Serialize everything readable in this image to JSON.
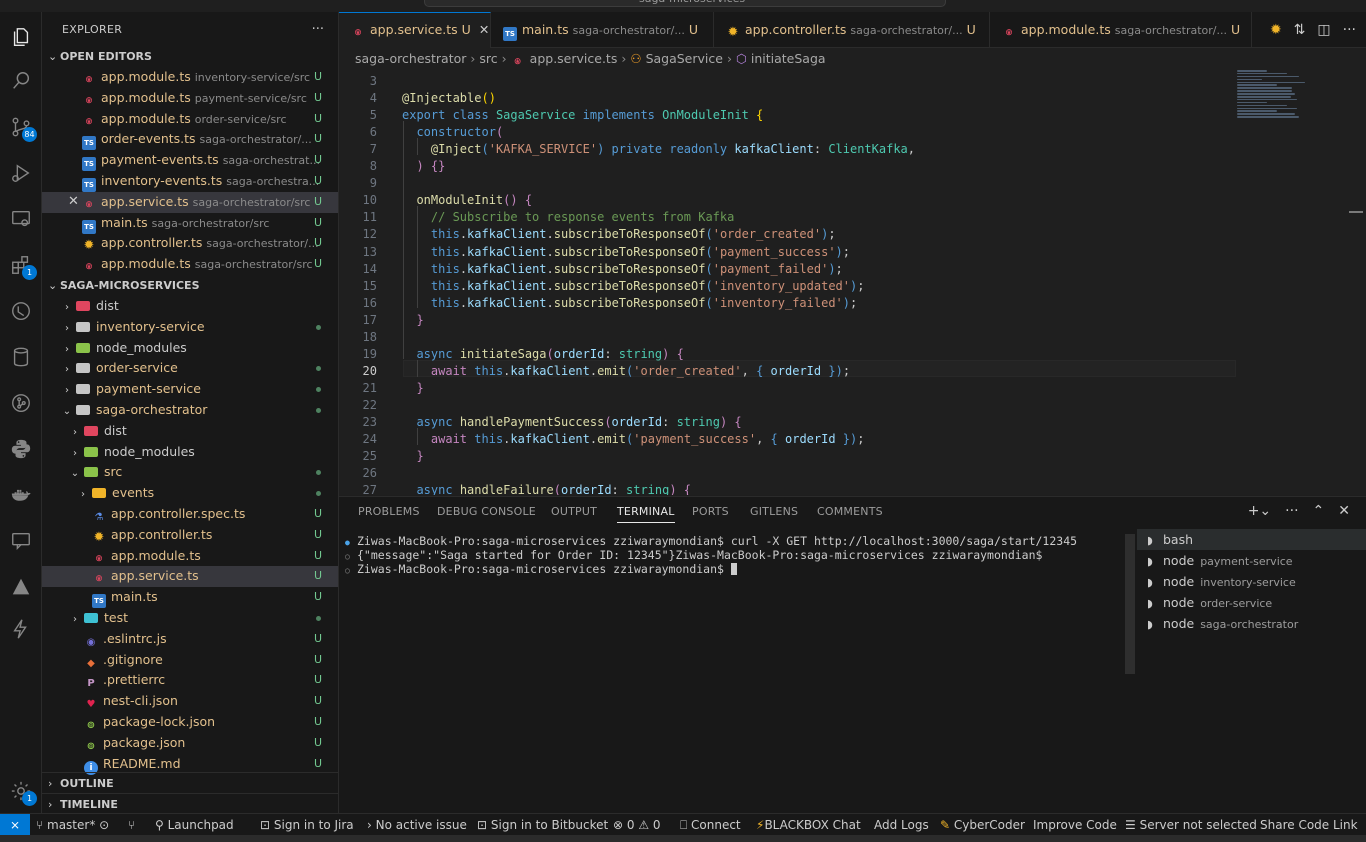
{
  "titlebar": {
    "search_text": "saga-microservices"
  },
  "explorer": {
    "title": "EXPLORER",
    "more": "···",
    "open_editors": {
      "label": "OPEN EDITORS",
      "items": [
        {
          "icon": "angular",
          "name": "app.module.ts",
          "desc": "inventory-service/src",
          "status": "U"
        },
        {
          "icon": "angular",
          "name": "app.module.ts",
          "desc": "payment-service/src",
          "status": "U"
        },
        {
          "icon": "angular",
          "name": "app.module.ts",
          "desc": "order-service/src",
          "status": "U"
        },
        {
          "icon": "ts",
          "name": "order-events.ts",
          "desc": "saga-orchestrator/...",
          "status": "U"
        },
        {
          "icon": "ts",
          "name": "payment-events.ts",
          "desc": "saga-orchestrat...",
          "status": "U"
        },
        {
          "icon": "ts",
          "name": "inventory-events.ts",
          "desc": "saga-orchestra...",
          "status": "U"
        },
        {
          "icon": "angular",
          "name": "app.service.ts",
          "desc": "saga-orchestrator/src",
          "status": "U"
        },
        {
          "icon": "ts",
          "name": "main.ts",
          "desc": "saga-orchestrator/src",
          "status": "U"
        },
        {
          "icon": "gear",
          "name": "app.controller.ts",
          "desc": "saga-orchestrator/...",
          "status": "U"
        },
        {
          "icon": "angular",
          "name": "app.module.ts",
          "desc": "saga-orchestrator/src",
          "status": "U"
        }
      ]
    },
    "workspace": {
      "label": "SAGA-MICROSERVICES",
      "items": [
        {
          "name": "dist",
          "status": ""
        },
        {
          "name": "inventory-service",
          "status": "dot"
        },
        {
          "name": "node_modules",
          "status": ""
        },
        {
          "name": "order-service",
          "status": "dot"
        },
        {
          "name": "payment-service",
          "status": "dot"
        },
        {
          "name": "saga-orchestrator",
          "status": "dot"
        },
        {
          "name": "dist",
          "status": ""
        },
        {
          "name": "node_modules",
          "status": ""
        },
        {
          "name": "src",
          "status": "dot"
        },
        {
          "name": "events",
          "status": "dot"
        },
        {
          "name": "app.controller.spec.ts",
          "status": "U"
        },
        {
          "name": "app.controller.ts",
          "status": "U"
        },
        {
          "name": "app.module.ts",
          "status": "U"
        },
        {
          "name": "app.service.ts",
          "status": "U"
        },
        {
          "name": "main.ts",
          "status": "U"
        },
        {
          "name": "test",
          "status": "dot"
        },
        {
          "name": ".eslintrc.js",
          "status": "U"
        },
        {
          "name": ".gitignore",
          "status": "U"
        },
        {
          "name": ".prettierrc",
          "status": "U"
        },
        {
          "name": "nest-cli.json",
          "status": "U"
        },
        {
          "name": "package-lock.json",
          "status": "U"
        },
        {
          "name": "package.json",
          "status": "U"
        },
        {
          "name": "README.md",
          "status": "U"
        }
      ]
    },
    "outline_label": "OUTLINE",
    "timeline_label": "TIMELINE"
  },
  "activity": {
    "scm_badge": "84",
    "ext_badge": "1",
    "accounts_badge": "1"
  },
  "tabs": [
    {
      "name": "app.service.ts",
      "status": "U",
      "desc": "",
      "active": true
    },
    {
      "name": "main.ts",
      "status": "",
      "desc": "saga-orchestrator/...",
      "statusAfter": "U"
    },
    {
      "name": "app.controller.ts",
      "status": "",
      "desc": "saga-orchestrator/...",
      "statusAfter": "U"
    },
    {
      "name": "app.module.ts",
      "status": "",
      "desc": "saga-orchestrator/...",
      "statusAfter": "U"
    }
  ],
  "breadcrumb": [
    "saga-orchestrator",
    "src",
    "app.service.ts",
    "SagaService",
    "initiateSaga"
  ],
  "editor": {
    "current_line": 20,
    "lines": [
      {
        "n": 3,
        "tokens": []
      },
      {
        "n": 4,
        "tokens": [
          [
            "fn",
            "@Injectable"
          ],
          [
            "pun",
            "()"
          ]
        ]
      },
      {
        "n": 5,
        "tokens": [
          [
            "kb",
            "export "
          ],
          [
            "kb",
            "class "
          ],
          [
            "cls",
            "SagaService "
          ],
          [
            "kb",
            "implements "
          ],
          [
            "cls",
            "OnModuleInit "
          ],
          [
            "pun",
            "{"
          ]
        ]
      },
      {
        "n": 6,
        "tokens": [
          [
            "",
            "  "
          ],
          [
            "kb",
            "constructor"
          ],
          [
            "kw",
            "("
          ]
        ]
      },
      {
        "n": 7,
        "tokens": [
          [
            "",
            "    "
          ],
          [
            "fn",
            "@Inject"
          ],
          [
            "kb",
            "("
          ],
          [
            "str",
            "'KAFKA_SERVICE'"
          ],
          [
            "kb",
            ") "
          ],
          [
            "kb",
            "private "
          ],
          [
            "kb",
            "readonly "
          ],
          [
            "prop",
            "kafkaClient"
          ],
          [
            "",
            ": "
          ],
          [
            "cls",
            "ClientKafka"
          ],
          [
            "",
            ","
          ]
        ]
      },
      {
        "n": 8,
        "tokens": [
          [
            "",
            "  "
          ],
          [
            "kw",
            ") {}"
          ]
        ]
      },
      {
        "n": 9,
        "tokens": []
      },
      {
        "n": 10,
        "tokens": [
          [
            "",
            "  "
          ],
          [
            "fn",
            "onModuleInit"
          ],
          [
            "kw",
            "() {"
          ]
        ]
      },
      {
        "n": 11,
        "tokens": [
          [
            "",
            "    "
          ],
          [
            "cmt",
            "// Subscribe to response events from Kafka"
          ]
        ]
      },
      {
        "n": 12,
        "tokens": [
          [
            "",
            "    "
          ],
          [
            "kb",
            "this"
          ],
          [
            "",
            "."
          ],
          [
            "prop",
            "kafkaClient"
          ],
          [
            "",
            "."
          ],
          [
            "fn",
            "subscribeToResponseOf"
          ],
          [
            "kb",
            "("
          ],
          [
            "str",
            "'order_created'"
          ],
          [
            "kb",
            ")"
          ],
          [
            "",
            ";"
          ]
        ]
      },
      {
        "n": 13,
        "tokens": [
          [
            "",
            "    "
          ],
          [
            "kb",
            "this"
          ],
          [
            "",
            "."
          ],
          [
            "prop",
            "kafkaClient"
          ],
          [
            "",
            "."
          ],
          [
            "fn",
            "subscribeToResponseOf"
          ],
          [
            "kb",
            "("
          ],
          [
            "str",
            "'payment_success'"
          ],
          [
            "kb",
            ")"
          ],
          [
            "",
            ";"
          ]
        ]
      },
      {
        "n": 14,
        "tokens": [
          [
            "",
            "    "
          ],
          [
            "kb",
            "this"
          ],
          [
            "",
            "."
          ],
          [
            "prop",
            "kafkaClient"
          ],
          [
            "",
            "."
          ],
          [
            "fn",
            "subscribeToResponseOf"
          ],
          [
            "kb",
            "("
          ],
          [
            "str",
            "'payment_failed'"
          ],
          [
            "kb",
            ")"
          ],
          [
            "",
            ";"
          ]
        ]
      },
      {
        "n": 15,
        "tokens": [
          [
            "",
            "    "
          ],
          [
            "kb",
            "this"
          ],
          [
            "",
            "."
          ],
          [
            "prop",
            "kafkaClient"
          ],
          [
            "",
            "."
          ],
          [
            "fn",
            "subscribeToResponseOf"
          ],
          [
            "kb",
            "("
          ],
          [
            "str",
            "'inventory_updated'"
          ],
          [
            "kb",
            ")"
          ],
          [
            "",
            ";"
          ]
        ]
      },
      {
        "n": 16,
        "tokens": [
          [
            "",
            "    "
          ],
          [
            "kb",
            "this"
          ],
          [
            "",
            "."
          ],
          [
            "prop",
            "kafkaClient"
          ],
          [
            "",
            "."
          ],
          [
            "fn",
            "subscribeToResponseOf"
          ],
          [
            "kb",
            "("
          ],
          [
            "str",
            "'inventory_failed'"
          ],
          [
            "kb",
            ")"
          ],
          [
            "",
            ";"
          ]
        ]
      },
      {
        "n": 17,
        "tokens": [
          [
            "",
            "  "
          ],
          [
            "kw",
            "}"
          ]
        ]
      },
      {
        "n": 18,
        "tokens": []
      },
      {
        "n": 19,
        "tokens": [
          [
            "",
            "  "
          ],
          [
            "kb",
            "async "
          ],
          [
            "fn",
            "initiateSaga"
          ],
          [
            "kw",
            "("
          ],
          [
            "prop",
            "orderId"
          ],
          [
            "",
            ": "
          ],
          [
            "cls",
            "string"
          ],
          [
            "kw",
            ") {"
          ]
        ]
      },
      {
        "n": 20,
        "tokens": [
          [
            "",
            "    "
          ],
          [
            "kw",
            "await "
          ],
          [
            "kb",
            "this"
          ],
          [
            "",
            "."
          ],
          [
            "prop",
            "kafkaClient"
          ],
          [
            "",
            "."
          ],
          [
            "fn",
            "emit"
          ],
          [
            "kb",
            "("
          ],
          [
            "str",
            "'order_created'"
          ],
          [
            "",
            ", "
          ],
          [
            "kb",
            "{ "
          ],
          [
            "prop",
            "orderId"
          ],
          [
            "kb",
            " }"
          ],
          [
            "kb",
            ")"
          ],
          [
            "",
            ";"
          ]
        ]
      },
      {
        "n": 21,
        "tokens": [
          [
            "",
            "  "
          ],
          [
            "kw",
            "}"
          ]
        ]
      },
      {
        "n": 22,
        "tokens": []
      },
      {
        "n": 23,
        "tokens": [
          [
            "",
            "  "
          ],
          [
            "kb",
            "async "
          ],
          [
            "fn",
            "handlePaymentSuccess"
          ],
          [
            "kw",
            "("
          ],
          [
            "prop",
            "orderId"
          ],
          [
            "",
            ": "
          ],
          [
            "cls",
            "string"
          ],
          [
            "kw",
            ") {"
          ]
        ]
      },
      {
        "n": 24,
        "tokens": [
          [
            "",
            "    "
          ],
          [
            "kw",
            "await "
          ],
          [
            "kb",
            "this"
          ],
          [
            "",
            "."
          ],
          [
            "prop",
            "kafkaClient"
          ],
          [
            "",
            "."
          ],
          [
            "fn",
            "emit"
          ],
          [
            "kb",
            "("
          ],
          [
            "str",
            "'payment_success'"
          ],
          [
            "",
            ", "
          ],
          [
            "kb",
            "{ "
          ],
          [
            "prop",
            "orderId"
          ],
          [
            "kb",
            " }"
          ],
          [
            "kb",
            ")"
          ],
          [
            "",
            ";"
          ]
        ]
      },
      {
        "n": 25,
        "tokens": [
          [
            "",
            "  "
          ],
          [
            "kw",
            "}"
          ]
        ]
      },
      {
        "n": 26,
        "tokens": []
      },
      {
        "n": 27,
        "tokens": [
          [
            "",
            "  "
          ],
          [
            "kb",
            "async "
          ],
          [
            "fn",
            "handleFailure"
          ],
          [
            "kw",
            "("
          ],
          [
            "prop",
            "orderId"
          ],
          [
            "",
            ": "
          ],
          [
            "cls",
            "string"
          ],
          [
            "kw",
            ") {"
          ]
        ]
      }
    ]
  },
  "panel": {
    "tabs": [
      "PROBLEMS",
      "DEBUG CONSOLE",
      "OUTPUT",
      "TERMINAL",
      "PORTS",
      "GITLENS",
      "COMMENTS"
    ],
    "active_tab": "TERMINAL",
    "terminal_lines": [
      "Ziwas-MacBook-Pro:saga-microservices zziwaraymondian$ curl -X GET http://localhost:3000/saga/start/12345",
      "{\"message\":\"Saga started for Order ID: 12345\"}Ziwas-MacBook-Pro:saga-microservices zziwaraymondian$",
      "Ziwas-MacBook-Pro:saga-microservices zziwaraymondian$ "
    ],
    "terminals": [
      {
        "name": "bash",
        "desc": ""
      },
      {
        "name": "node",
        "desc": "payment-service"
      },
      {
        "name": "node",
        "desc": "inventory-service"
      },
      {
        "name": "node",
        "desc": "order-service"
      },
      {
        "name": "node",
        "desc": "saga-orchestrator"
      }
    ]
  },
  "statusbar": {
    "branch": "master*",
    "items": [
      "Launchpad",
      "Sign in to Jira",
      "No active issue",
      "Sign in to Bitbucket",
      "0",
      "0",
      "Connect",
      "BLACKBOX Chat",
      "Add Logs",
      "CyberCoder",
      "Improve Code",
      "Server not selected",
      "Share Code Link"
    ]
  }
}
